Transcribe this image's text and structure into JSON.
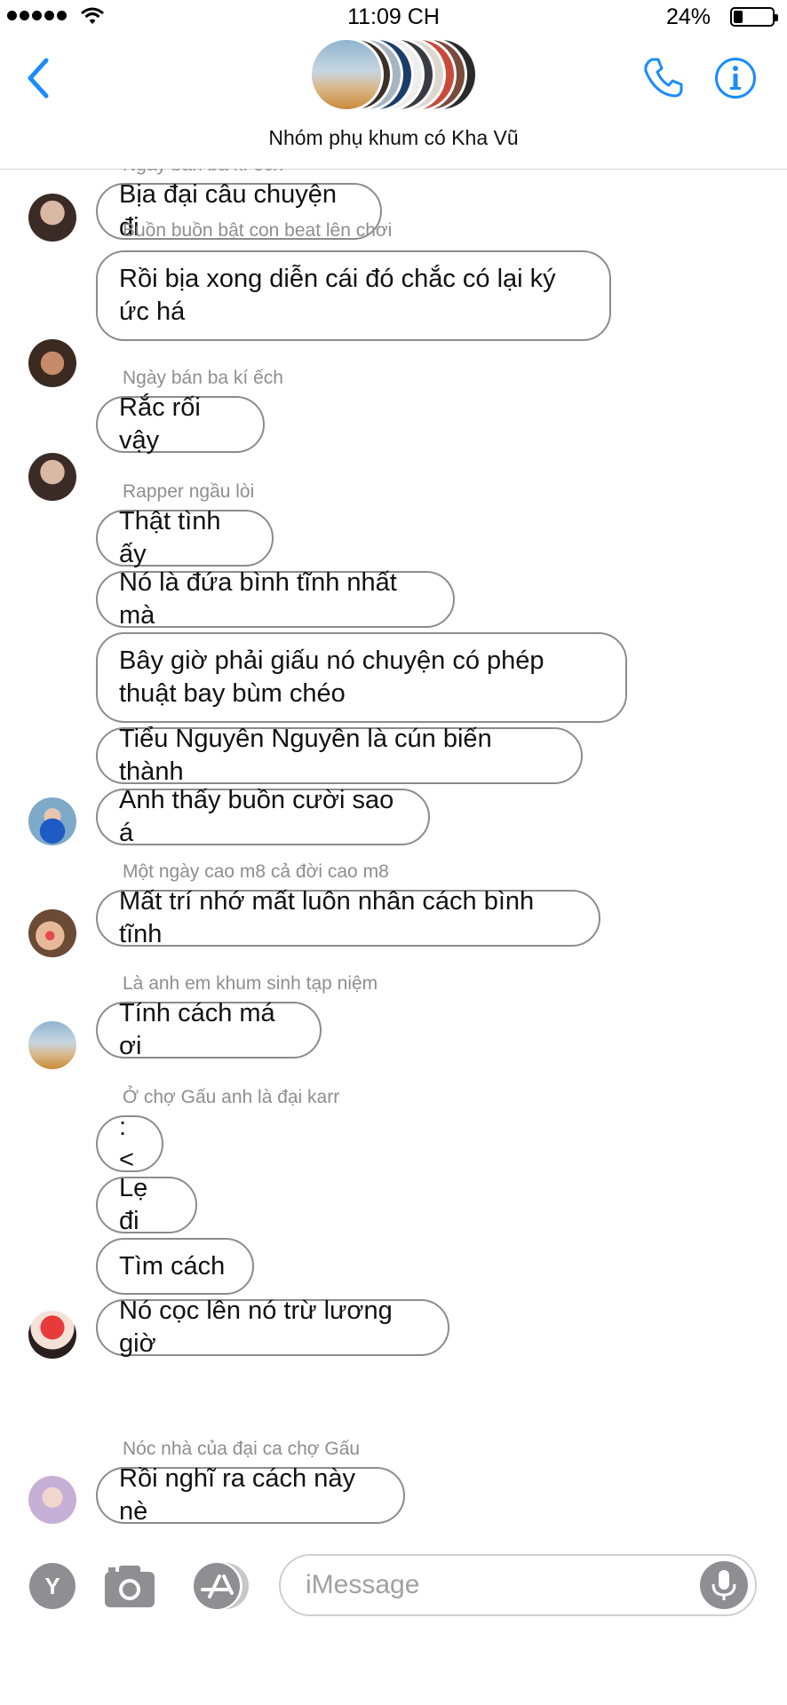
{
  "status_bar": {
    "time": "11:09 CH",
    "battery": "24%",
    "battery_level": 0.24
  },
  "header": {
    "group_name": "Nhóm phụ khum có Kha Vũ"
  },
  "messages": {
    "partial_sender": "Ngày bán ba kí ếch",
    "bubbles": [
      "Bịa đại câu chuyện đi",
      "Rồi bịa xong diễn cái đó chắc có lại ký ức há",
      "Rắc rối vậy",
      "Thật tình ấy",
      "Nó là đứa bình tĩnh nhất mà",
      "Bây giờ phải giấu nó chuyện có phép thuật bay bùm chéo",
      "Tiểu Nguyên Nguyên là cún biến thành",
      "Anh thấy buồn cười sao á",
      "Mất trí nhớ mất luôn nhân cách bình tĩnh",
      "Tính cách má ơi",
      ":<",
      "Lẹ đi",
      "Tìm cách",
      "Nó cọc lên nó trừ lương giờ",
      "Rồi nghĩ ra cách này nè"
    ],
    "senders": [
      "Buồn buồn bật con beat lên chơi",
      "Ngày bán ba kí ếch",
      "Rapper ngầu lòi",
      "Một ngày cao m8 cả đời cao m8",
      "Là anh em khum sinh tạp niệm",
      "Ở chợ Gấu anh là đại karr",
      "Nóc nhà của đại ca chợ Gấu"
    ]
  },
  "input_bar": {
    "placeholder": "iMessage",
    "app_button_letter": "Y"
  },
  "colors": {
    "accent": "#1a8cff",
    "bubble_border": "#8c8c8e",
    "meta_text": "#8e8e93",
    "icon_gray": "#8e8e93"
  }
}
